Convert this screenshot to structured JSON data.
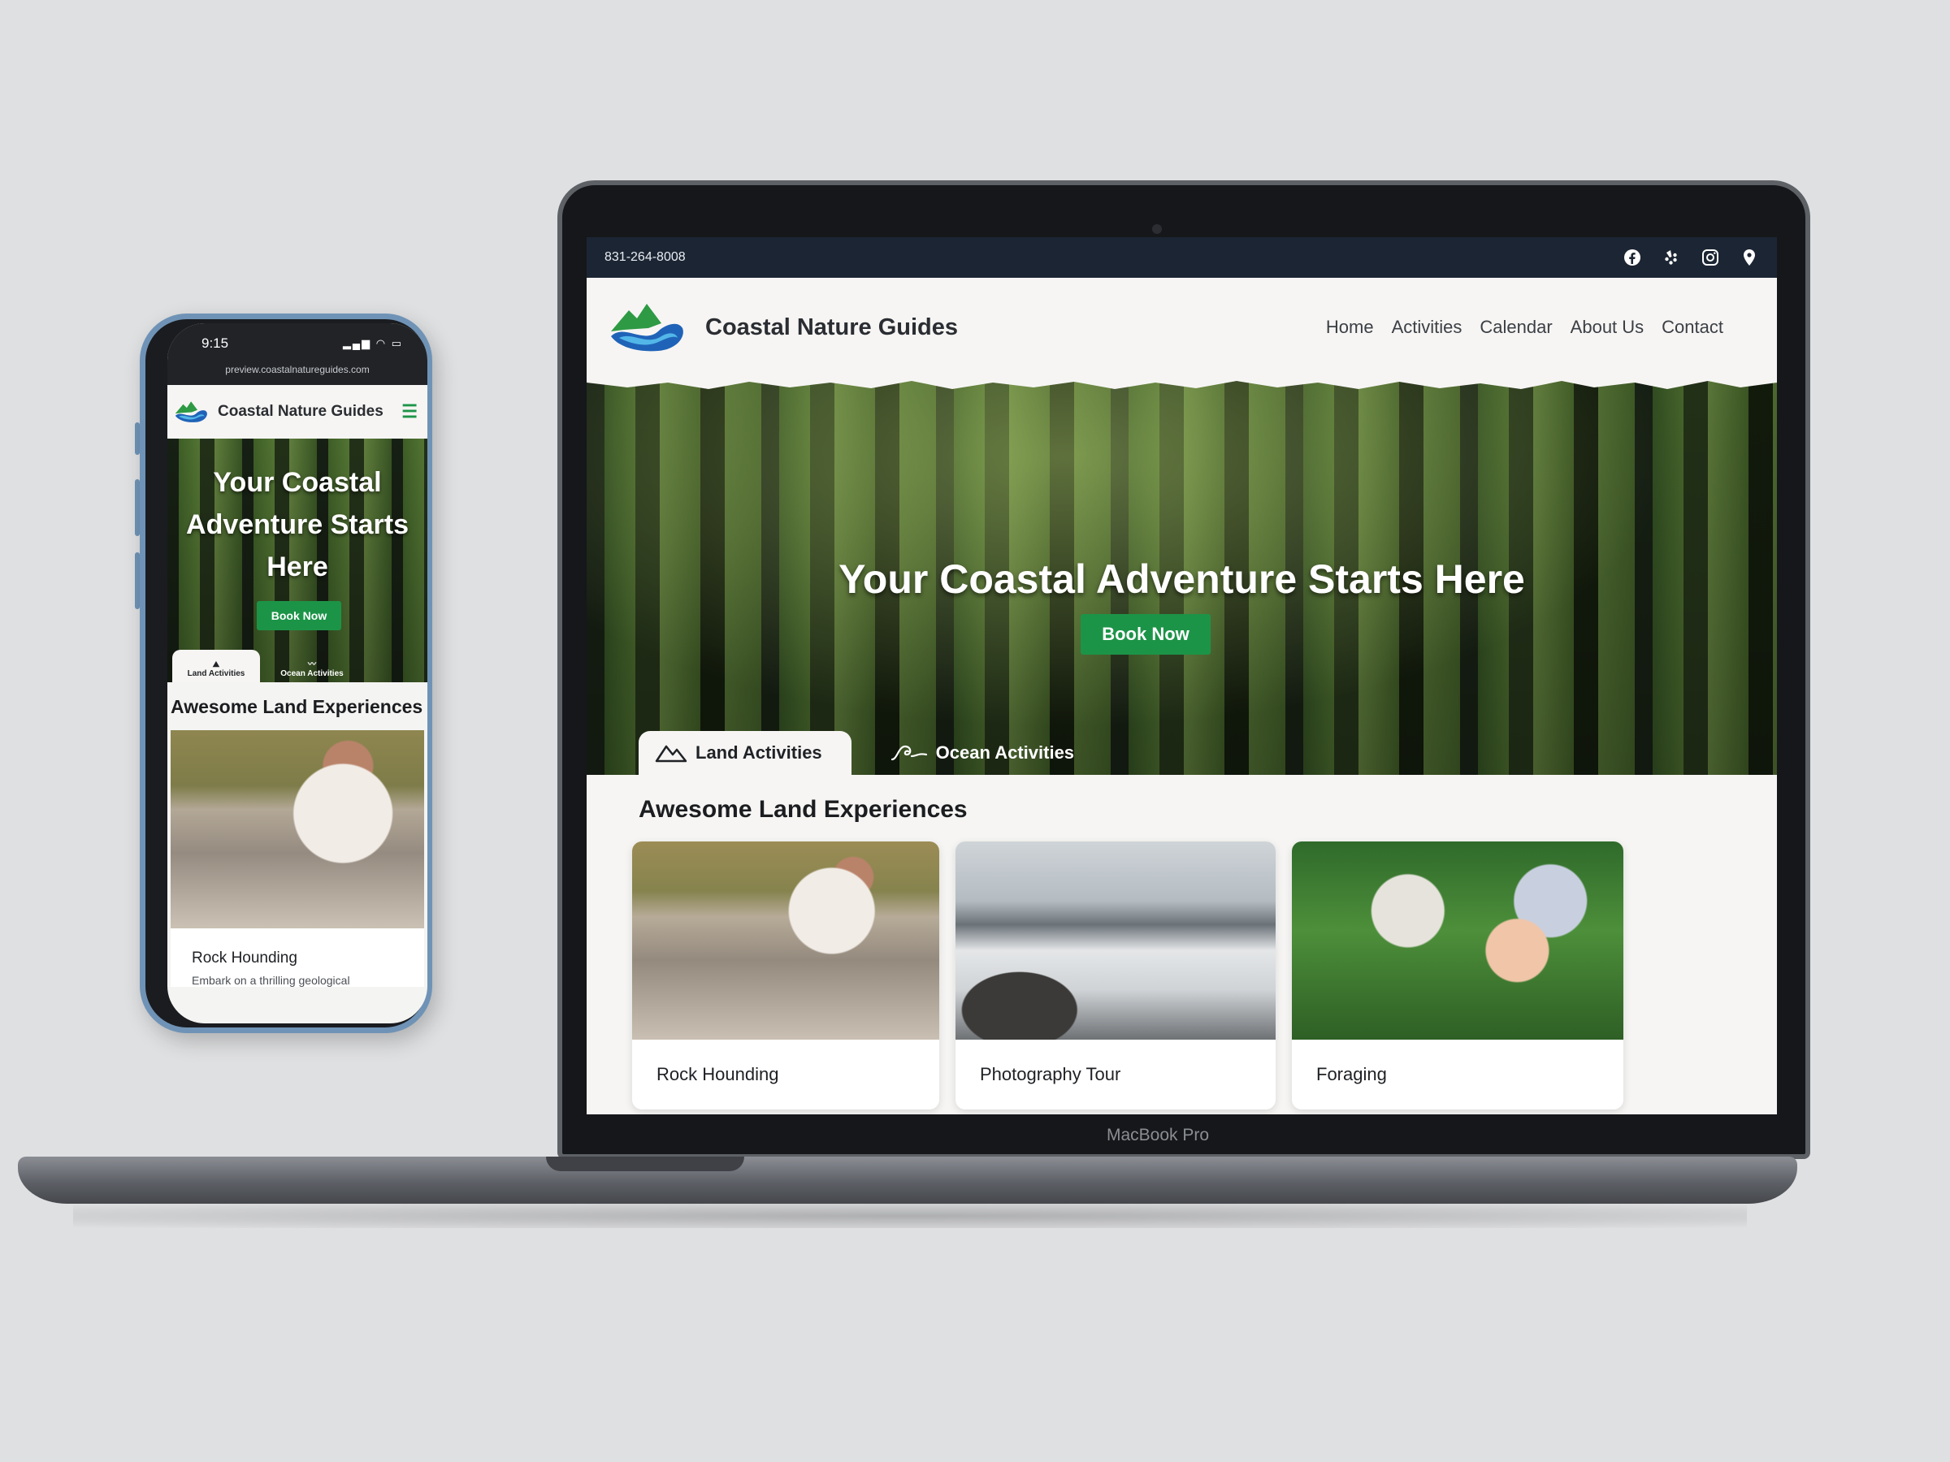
{
  "desktop": {
    "topbar": {
      "phone": "831-264-8008",
      "icons": [
        "facebook-icon",
        "yelp-icon",
        "instagram-icon",
        "location-pin-icon"
      ]
    },
    "header": {
      "brand": "Coastal Nature Guides",
      "nav": [
        "Home",
        "Activities",
        "Calendar",
        "About Us",
        "Contact"
      ]
    },
    "hero": {
      "title": "Your Coastal Adventure Starts Here",
      "cta": "Book Now"
    },
    "tabs": [
      {
        "label": "Land Activities",
        "icon": "mountain-icon",
        "active": true
      },
      {
        "label": "Ocean Activities",
        "icon": "wave-icon",
        "active": false
      }
    ],
    "section_title": "Awesome Land Experiences",
    "cards": [
      {
        "title": "Rock Hounding"
      },
      {
        "title": "Photography Tour"
      },
      {
        "title": "Foraging"
      }
    ],
    "device_label": "MacBook Pro"
  },
  "mobile": {
    "status": {
      "time": "9:15"
    },
    "url": "preview.coastalnatureguides.com",
    "header": {
      "brand": "Coastal Nature Guides"
    },
    "hero": {
      "title": "Your Coastal Adventure Starts Here",
      "cta": "Book Now"
    },
    "tabs": [
      {
        "label": "Land Activities",
        "active": true
      },
      {
        "label": "Ocean Activities",
        "active": false
      }
    ],
    "section_title": "Awesome Land Experiences",
    "card": {
      "title": "Rock Hounding",
      "description": "Embark on a thrilling geological"
    }
  },
  "colors": {
    "accent_green": "#1c9448",
    "topbar_navy": "#1c2533",
    "page_bg": "#f6f5f3"
  }
}
